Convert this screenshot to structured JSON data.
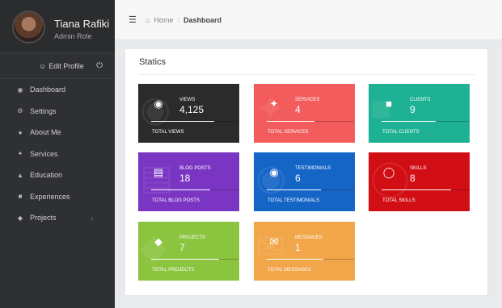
{
  "profile": {
    "name": "Tiana Rafiki",
    "role": "Admin Role",
    "edit_label": "Edit Profile"
  },
  "sidebar": {
    "items": [
      {
        "label": "Dashboard",
        "icon": "dashboard-icon"
      },
      {
        "label": "Settings",
        "icon": "gear-icon"
      },
      {
        "label": "About Me",
        "icon": "user-icon"
      },
      {
        "label": "Services",
        "icon": "wand-icon"
      },
      {
        "label": "Education",
        "icon": "graduation-cap-icon"
      },
      {
        "label": "Experiences",
        "icon": "briefcase-icon"
      },
      {
        "label": "Projects",
        "icon": "tag-icon",
        "has_submenu": true
      }
    ]
  },
  "breadcrumb": {
    "home": "Home",
    "current": "Dashboard"
  },
  "panel": {
    "title": "Statics"
  },
  "cards": [
    {
      "label": "VIEWS",
      "value": "4,125",
      "total_label": "TOTAL VIEWS",
      "color": "#2b2b2b",
      "icon": "eye-icon",
      "progress": 0.72
    },
    {
      "label": "SERVICES",
      "value": "4",
      "total_label": "TOTAL SERVICES",
      "color": "#f25c5c",
      "icon": "wand-icon",
      "progress": 0.55
    },
    {
      "label": "CLIENTS",
      "value": "9",
      "total_label": "TOTAL CLIENTS",
      "color": "#1fb194",
      "icon": "briefcase-icon",
      "progress": 0.62
    },
    {
      "label": "BLOG POSTS",
      "value": "18",
      "total_label": "TOTAL BLOG POSTS",
      "color": "#7a35c2",
      "icon": "newspaper-icon",
      "progress": 0.68
    },
    {
      "label": "TESTIMONIALS",
      "value": "6",
      "total_label": "TOTAL TESTIMONIALS",
      "color": "#1565c7",
      "icon": "comments-icon",
      "progress": 0.62
    },
    {
      "label": "SKILLS",
      "value": "8",
      "total_label": "TOTAL SKILLS",
      "color": "#d10e14",
      "icon": "lightbulb-icon",
      "progress": 0.8
    },
    {
      "label": "PROJECTS",
      "value": "7",
      "total_label": "TOTAL PROJECTS",
      "color": "#8bc43f",
      "icon": "tags-icon",
      "progress": 0.78
    },
    {
      "label": "MESSAGES",
      "value": "1",
      "total_label": "TOTAL MESSAGES",
      "color": "#f2a64a",
      "icon": "envelope-icon",
      "progress": 0.65
    }
  ]
}
